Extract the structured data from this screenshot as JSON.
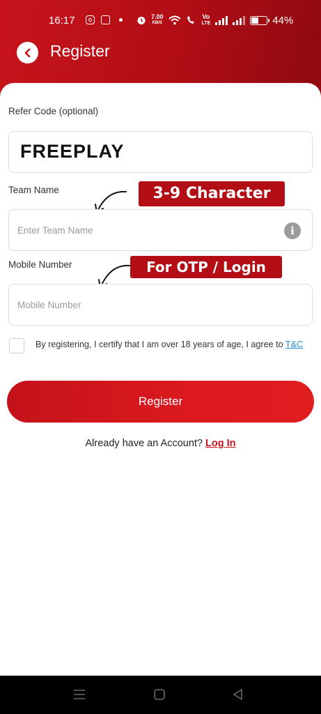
{
  "status_bar": {
    "time": "16:17",
    "net_speed_value": "7.00",
    "net_speed_unit": "KB/S",
    "volte_line1": "Vo",
    "volte_line2": "LTE",
    "battery": "44%",
    "battery_level": 0.44
  },
  "header": {
    "title": "Register"
  },
  "form": {
    "refer_label": "Refer Code (optional)",
    "refer_value": "FREEPLAY",
    "team_label": "Team Name",
    "team_placeholder": "Enter Team Name",
    "mobile_label": "Mobile Number",
    "mobile_placeholder": "Mobile Number",
    "terms_text": "By registering, I certify that I am over 18 years of age, I agree to ",
    "terms_link": "T&C",
    "register_label": "Register",
    "login_prompt": "Already have an Account?",
    "login_link": "Log In"
  },
  "callouts": {
    "team": "3-9 Character",
    "mobile": "For OTP / Login"
  },
  "colors": {
    "brand": "#c8141c",
    "link": "#1f8fd6"
  }
}
